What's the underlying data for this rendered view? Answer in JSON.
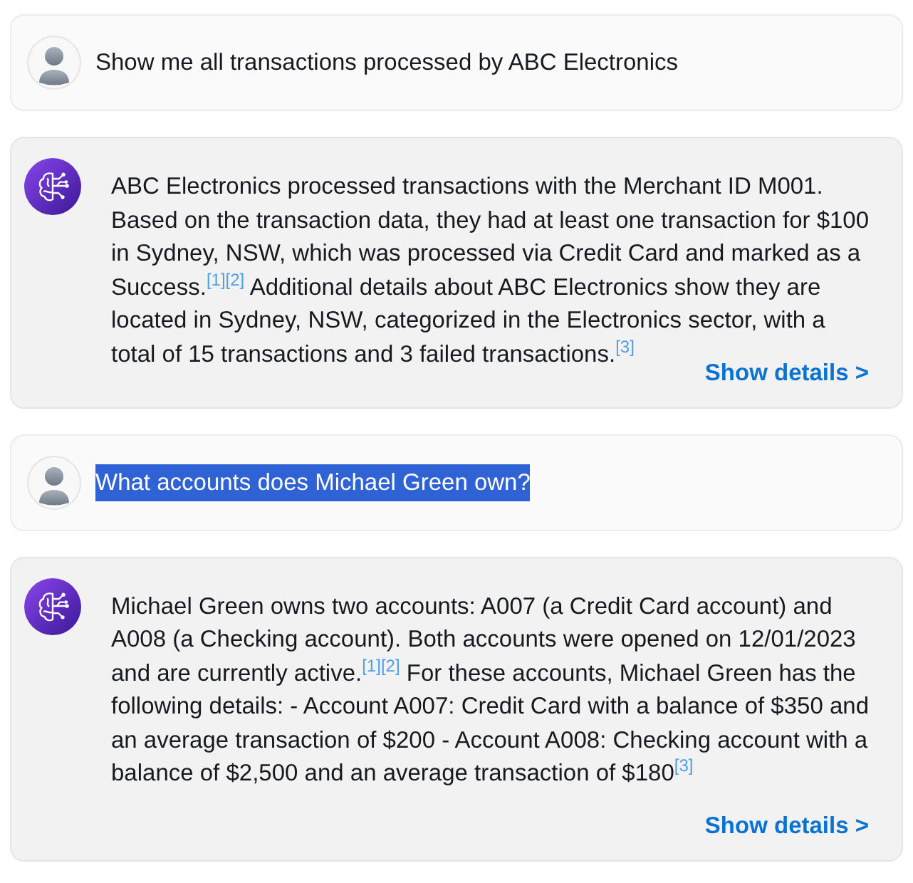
{
  "messages": [
    {
      "kind": "user",
      "text": "Show me all transactions processed by ABC Electronics",
      "text_selected": false
    },
    {
      "kind": "assistant",
      "text": "ABC Electronics processed transactions with the Merchant ID M001. Based on the transaction data, they had at least one transaction for $100 in Sydney, NSW, which was processed via Credit Card and marked as a Success.$^{[1]}$$^{[2]}$ Additional details about ABC Electronics show they are located in Sydney, NSW, categorized in the Electronics sector, with a total of 15 transactions and 3 failed transactions.$^{[3]}$",
      "link": "Show details >"
    },
    {
      "kind": "user",
      "text": "What accounts does Michael Green own?",
      "text_selected": true
    },
    {
      "kind": "assistant",
      "text": "Michael Green owns two accounts: A007 (a Credit Card account) and A008 (a Checking account). Both accounts were opened on 12/01/2023 and are currently active.$^{[1]}$$^{[2]}$ For these accounts, Michael Green has the following details: - Account A007: Credit Card with a balance of $350 and an average transaction of $200 - Account A008: Checking account with a balance of $2,500 and an average transaction of $180$^{[3]}$",
      "link": "Show details >"
    }
  ]
}
